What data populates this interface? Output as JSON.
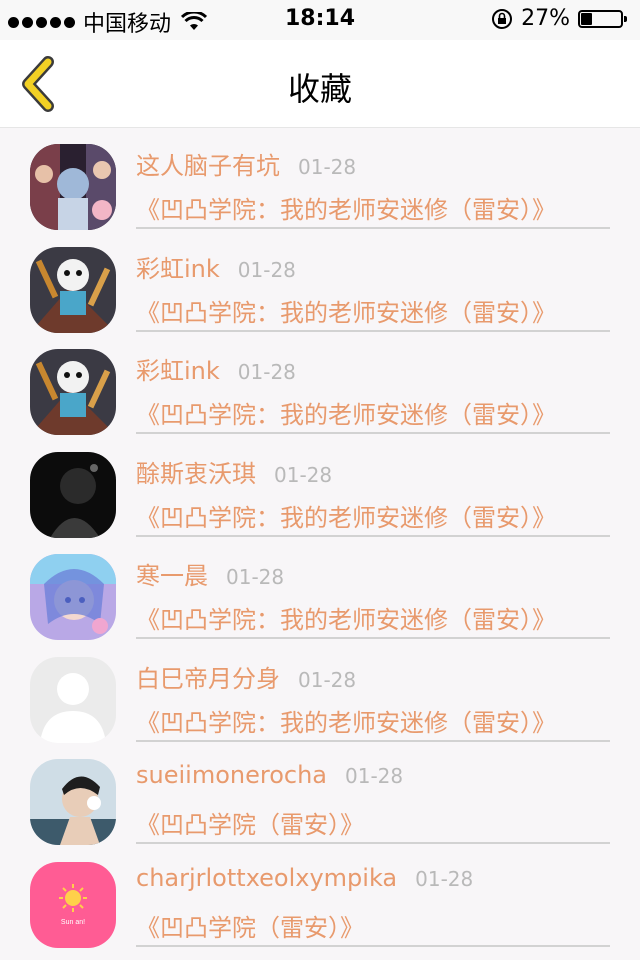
{
  "status_bar": {
    "carrier": "中国移动",
    "time": "18:14",
    "battery": "27%"
  },
  "nav": {
    "title": "收藏",
    "back_icon": "chevron-left-icon",
    "accent_color": "#f2d024"
  },
  "colors": {
    "name_text": "#e89a6d",
    "date_text": "#b9b9b9"
  },
  "items": [
    {
      "name": "这人脑子有坑",
      "date": "01-28",
      "title": "《凹凸学院：我的老师安迷修（雷安）》"
    },
    {
      "name": "彩虹ink",
      "date": "01-28",
      "title": "《凹凸学院：我的老师安迷修（雷安）》"
    },
    {
      "name": "彩虹ink",
      "date": "01-28",
      "title": "《凹凸学院：我的老师安迷修（雷安）》"
    },
    {
      "name": "酴斯衷沃琪",
      "date": "01-28",
      "title": "《凹凸学院：我的老师安迷修（雷安）》"
    },
    {
      "name": "寒一晨",
      "date": "01-28",
      "title": "《凹凸学院：我的老师安迷修（雷安）》"
    },
    {
      "name": "白巳帝月分身",
      "date": "01-28",
      "title": "《凹凸学院：我的老师安迷修（雷安）》"
    },
    {
      "name": "sueiimonerocha",
      "date": "01-28",
      "title": "《凹凸学院（雷安）》"
    },
    {
      "name": "charjrlottxeolxympika",
      "date": "01-28",
      "title": "《凹凸学院（雷安）》",
      "avatar_text": "Sun an!"
    }
  ]
}
